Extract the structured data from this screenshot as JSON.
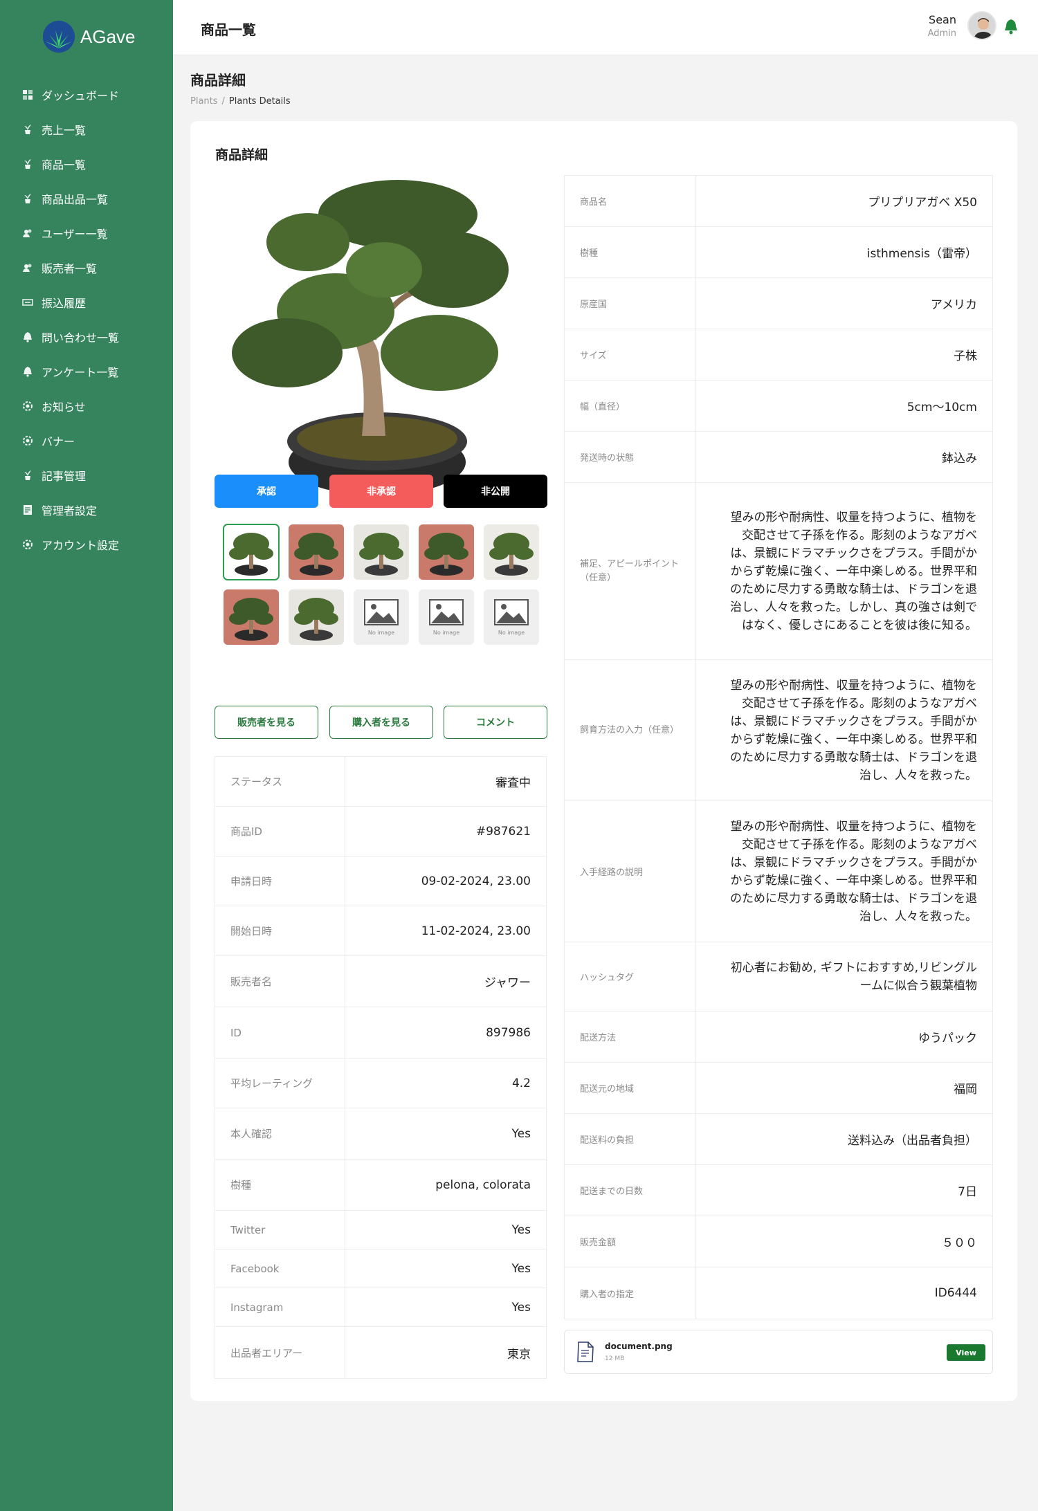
{
  "brand": {
    "name": "AGave"
  },
  "sidebar": {
    "items": [
      {
        "label": "ダッシュボード",
        "icon": "dashboard-icon"
      },
      {
        "label": "売上一覧",
        "icon": "plant-pot-icon"
      },
      {
        "label": "商品一覧",
        "icon": "plant-pot-icon"
      },
      {
        "label": "商品出品一覧",
        "icon": "plant-pot-icon"
      },
      {
        "label": "ユーザー一覧",
        "icon": "users-icon"
      },
      {
        "label": "販売者一覧",
        "icon": "users-icon"
      },
      {
        "label": "振込履歴",
        "icon": "transfer-icon"
      },
      {
        "label": "問い合わせ一覧",
        "icon": "bell-icon"
      },
      {
        "label": "アンケート一覧",
        "icon": "bell-icon"
      },
      {
        "label": "お知らせ",
        "icon": "gear-icon"
      },
      {
        "label": "バナー",
        "icon": "gear-icon"
      },
      {
        "label": "記事管理",
        "icon": "plant-pot-icon"
      },
      {
        "label": "管理者設定",
        "icon": "document-icon"
      },
      {
        "label": "アカウント設定",
        "icon": "gear-icon"
      }
    ]
  },
  "topbar": {
    "title": "商品一覧",
    "user_name": "Sean",
    "user_role": "Admin"
  },
  "page": {
    "title": "商品詳細",
    "breadcrumb": {
      "parent": "Plants",
      "sep": "/",
      "current": "Plants Details"
    }
  },
  "card": {
    "title": "商品詳細"
  },
  "gallery": {
    "no_image_label": "No image",
    "thumbnails": [
      "photo",
      "photo",
      "photo",
      "photo",
      "photo",
      "photo",
      "photo",
      "no-image",
      "no-image",
      "no-image"
    ]
  },
  "actions": {
    "approve": "承認",
    "reject": "非承認",
    "unpublish": "非公開",
    "view_seller": "販売者を見る",
    "view_buyer": "購入者を見る",
    "comment": "コメント"
  },
  "left_details": [
    {
      "label": "ステータス",
      "value": "審査中"
    },
    {
      "label": "商品ID",
      "value": "#987621"
    },
    {
      "label": "申請日時",
      "value": "09-02-2024, 23.00"
    },
    {
      "label": "開始日時",
      "value": "11-02-2024, 23.00"
    },
    {
      "label": "販売者名",
      "value": "ジャワー"
    },
    {
      "label": "ID",
      "value": "897986"
    },
    {
      "label": "平均レーティング",
      "value": "4.2"
    },
    {
      "label": "本人確認",
      "value": "Yes"
    },
    {
      "label": "樹種",
      "value": "pelona, colorata"
    },
    {
      "label": "Twitter",
      "value": "Yes"
    },
    {
      "label": "Facebook",
      "value": "Yes"
    },
    {
      "label": "Instagram",
      "value": "Yes"
    },
    {
      "label": "出品者エリアー",
      "value": "東京"
    }
  ],
  "right_details": [
    {
      "label": "商品名",
      "value": "プリプリアガベ X50"
    },
    {
      "label": "樹種",
      "value": "isthmensis（雷帝）"
    },
    {
      "label": "原産国",
      "value": "アメリカ"
    },
    {
      "label": "サイズ",
      "value": "子株"
    },
    {
      "label": "幅（直径）",
      "value": "5cm〜10cm"
    },
    {
      "label": "発送時の状態",
      "value": "鉢込み"
    },
    {
      "label": "補足、アピールポイント（任意）",
      "value": "望みの形や耐病性、収量を持つように、植物を交配させて子孫を作る。彫刻のようなアガベは、景観にドラマチックさをプラス。手間がかからず乾燥に強く、一年中楽しめる。世界平和のために尽力する勇敢な騎士は、ドラゴンを退治し、人々を救った。しかし、真の強さは剣ではなく、優しさにあることを彼は後に知る。"
    },
    {
      "label": "飼育方法の入力（任意）",
      "value": "望みの形や耐病性、収量を持つように、植物を交配させて子孫を作る。彫刻のようなアガベは、景観にドラマチックさをプラス。手間がかからず乾燥に強く、一年中楽しめる。世界平和のために尽力する勇敢な騎士は、ドラゴンを退治し、人々を救った。"
    },
    {
      "label": "入手経路の説明",
      "value": "望みの形や耐病性、収量を持つように、植物を交配させて子孫を作る。彫刻のようなアガベは、景観にドラマチックさをプラス。手間がかからず乾燥に強く、一年中楽しめる。世界平和のために尽力する勇敢な騎士は、ドラゴンを退治し、人々を救った。"
    },
    {
      "label": "ハッシュタグ",
      "value": "初心者にお勧め, ギフトにおすすめ,リビングルームに似合う観葉植物"
    },
    {
      "label": "配送方法",
      "value": "ゆうパック"
    },
    {
      "label": "配送元の地域",
      "value": "福岡"
    },
    {
      "label": "配送料の負担",
      "value": "送料込み（出品者負担）"
    },
    {
      "label": "配送までの日数",
      "value": "7日"
    },
    {
      "label": "販売金額",
      "value": "５００"
    },
    {
      "label": "購入者の指定",
      "value": "ID6444"
    }
  ],
  "document": {
    "name": "document.png",
    "size": "12 MB",
    "button": "View"
  },
  "colors": {
    "sidebar": "#35845e",
    "accent_green": "#2a7a3e",
    "approve_blue": "#1a8ffb",
    "reject_red": "#f45b5b"
  }
}
